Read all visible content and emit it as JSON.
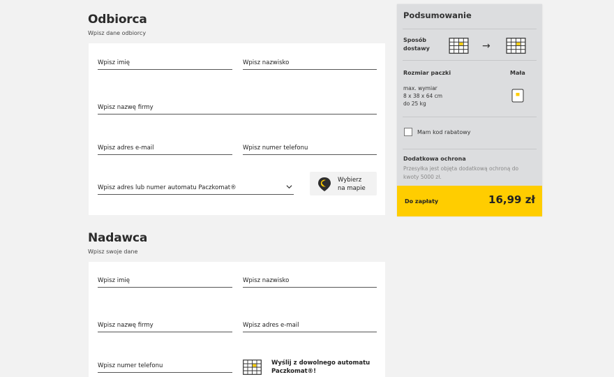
{
  "recipient": {
    "title": "Odbiorca",
    "subtitle": "Wpisz dane odbiorcy",
    "first_name": "Wpisz imię",
    "last_name": "Wpisz nazwisko",
    "company": "Wpisz nazwę firmy",
    "email": "Wpisz adres e-mail",
    "phone": "Wpisz numer telefonu",
    "locker": "Wpisz adres lub numer automatu Paczkomat®",
    "map_button": [
      "Wybierz",
      "na mapie"
    ]
  },
  "sender": {
    "title": "Nadawca",
    "subtitle": "Wpisz swoje dane",
    "first_name": "Wpisz imię",
    "last_name": "Wpisz nazwisko",
    "company": "Wpisz nazwę firmy",
    "email": "Wpisz adres e-mail",
    "phone": "Wpisz numer telefonu",
    "send_from": [
      "Wyślij z dowolnego automatu",
      "Paczkomat®!"
    ]
  },
  "summary": {
    "title": "Podsumowanie",
    "delivery_label": [
      "Sposób",
      "dostawy"
    ],
    "size_label": "Rozmiar paczki",
    "size_value": "Mała",
    "dimensions": [
      "max. wymiar",
      "8 x 38 x 64 cm",
      "do 25 kg"
    ],
    "discount_label": "Mam kod rabatowy",
    "discount_checked": false,
    "protection_title": "Dodatkowa ochrona",
    "protection_text": [
      "Przesyłka jest objęta dodatkową ochroną do",
      "kwoty 5000 zł."
    ],
    "pay_label": "Do zapłaty",
    "price": "16,99 zł"
  },
  "colors": {
    "accent": "#ffcd00",
    "panel": "#dcdddf",
    "background": "#f2f2f2"
  }
}
